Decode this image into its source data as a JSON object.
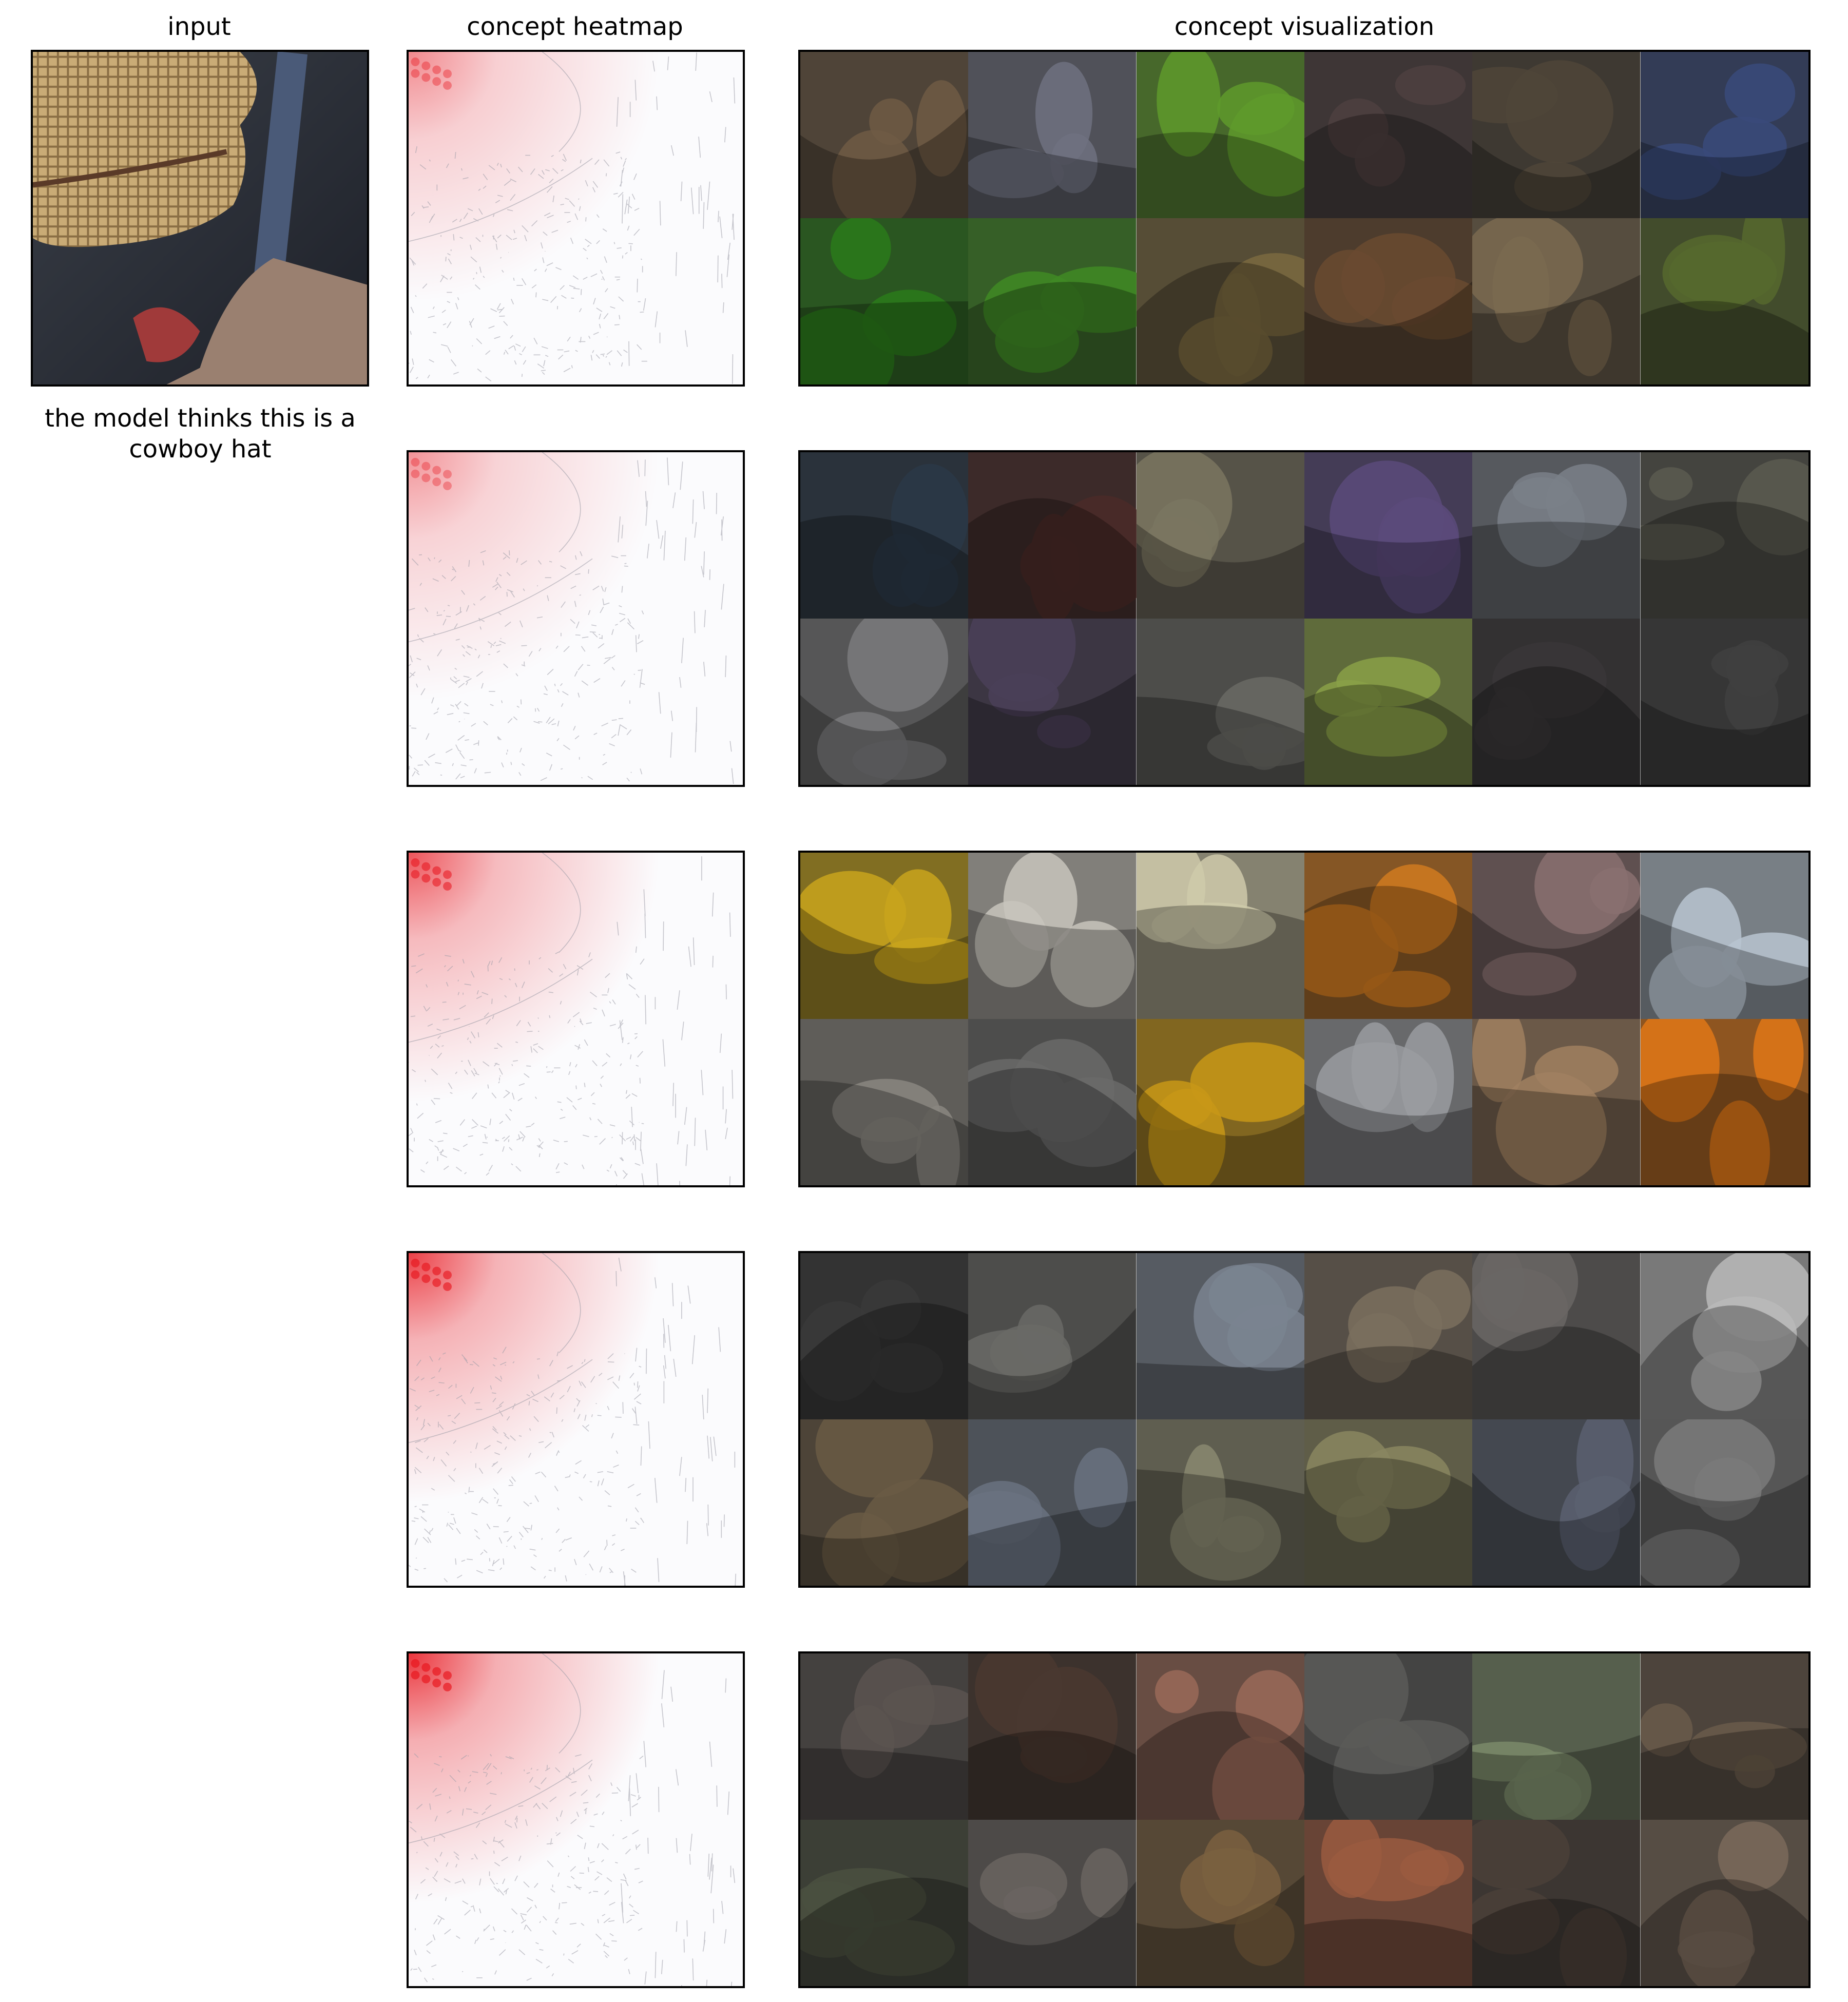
{
  "headers": {
    "input": "input",
    "heatmap": "concept heatmap",
    "visualization": "concept visualization"
  },
  "input_caption": "the model thinks this is a cowboy hat",
  "heatmap_color": "#e8141c",
  "concepts": [
    {
      "tiles": [
        "#6e5a44",
        "#6f7180",
        "#5f9a2c",
        "#4e4040",
        "#4f4538",
        "#3a4a7a",
        "#2a7a1a",
        "#3f8a24",
        "#7a6a40",
        "#6a4a30",
        "#7a6a50",
        "#56682e"
      ]
    },
    {
      "tiles": [
        "#2a3848",
        "#4a2a28",
        "#7a7560",
        "#5a4a7a",
        "#7a8088",
        "#5a5a50",
        "#7a7a7c",
        "#4a4058",
        "#6a6a64",
        "#8aa048",
        "#3a3638",
        "#404040"
      ]
    },
    {
      "tiles": [
        "#c9a51c",
        "#c8c4bc",
        "#cfcaaa",
        "#d07a20",
        "#8a7070",
        "#b8c4d0",
        "#8a8680",
        "#6a6a68",
        "#c89818",
        "#9a9ca0",
        "#a08060",
        "#e07818"
      ]
    },
    {
      "tiles": [
        "#3a3a3a",
        "#6a6a66",
        "#7a8490",
        "#7a6e5e",
        "#6a6664",
        "#bababa",
        "#6a5a44",
        "#6a7280",
        "#8a8870",
        "#8a8660",
        "#5a6070",
        "#7a7a7a"
      ]
    },
    {
      "tiles": [
        "#5a5450",
        "#4a3830",
        "#9a6a58",
        "#5a5a58",
        "#7a8a6a",
        "#6a5a4a",
        "#4a5040",
        "#6a6460",
        "#7a6040",
        "#9a5a40",
        "#4a4038",
        "#7a6a5a"
      ]
    }
  ]
}
